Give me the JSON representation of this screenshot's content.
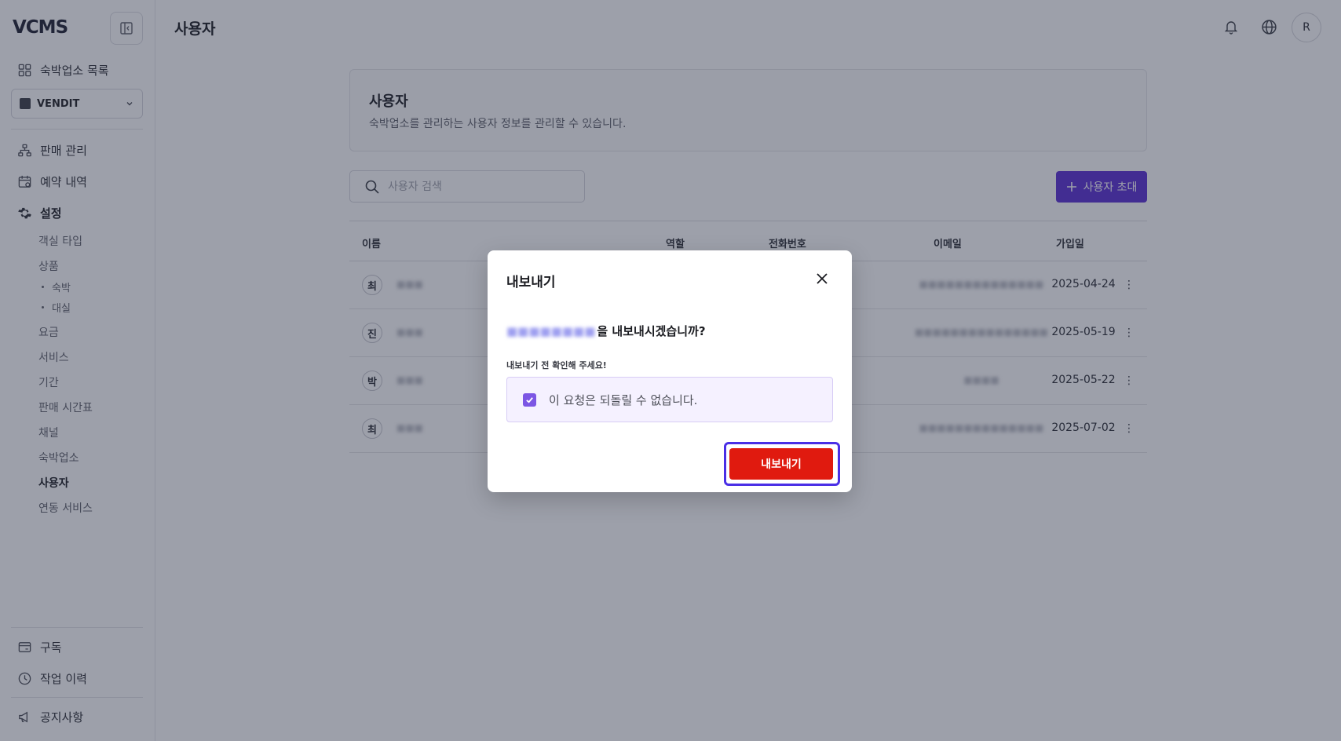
{
  "app": {
    "logo": "VCMS",
    "page_title": "사용자",
    "avatar_initial": "R"
  },
  "sidebar": {
    "property_list_label": "숙박업소 목록",
    "selected_property": "VENDIT",
    "nav": [
      {
        "label": "판매 관리",
        "icon": "sitemap-icon"
      },
      {
        "label": "예약 내역",
        "icon": "calendar-icon"
      },
      {
        "label": "설정",
        "icon": "gear-icon"
      }
    ],
    "settings_items": {
      "room_type": "객실 타입",
      "product": "상품",
      "product_sub": [
        "숙박",
        "대실"
      ],
      "rate": "요금",
      "service": "서비스",
      "period": "기간",
      "sales_schedule": "판매 시간표",
      "channel": "채널",
      "property": "숙박업소",
      "user": "사용자",
      "integration": "연동 서비스"
    },
    "bottom": {
      "subscription": "구독",
      "history": "작업 이력",
      "notice": "공지사항"
    }
  },
  "main": {
    "card_title": "사용자",
    "card_desc": "숙박업소를 관리하는 사용자 정보를 관리할 수 있습니다.",
    "search_placeholder": "사용자 검색",
    "invite_label": "사용자 초대",
    "columns": {
      "name": "이름",
      "role": "역할",
      "phone": "전화번호",
      "email": "이메일",
      "joined": "가입일"
    },
    "rows": [
      {
        "initial": "최",
        "date": "2025-04-24"
      },
      {
        "initial": "진",
        "date": "2025-05-19"
      },
      {
        "initial": "박",
        "date": "2025-05-22"
      },
      {
        "initial": "최",
        "date": "2025-07-02"
      }
    ]
  },
  "modal": {
    "title": "내보내기",
    "question_suffix": "을 내보내시겠습니까?",
    "confirm_label": "내보내기 전 확인해 주세요!",
    "confirm_text": "이 요청은 되돌릴 수 없습니다.",
    "confirm_checked": true,
    "submit_label": "내보내기"
  },
  "colors": {
    "accent": "#5a2fd4",
    "danger": "#e01a0f",
    "focus": "#4a2fe6"
  }
}
